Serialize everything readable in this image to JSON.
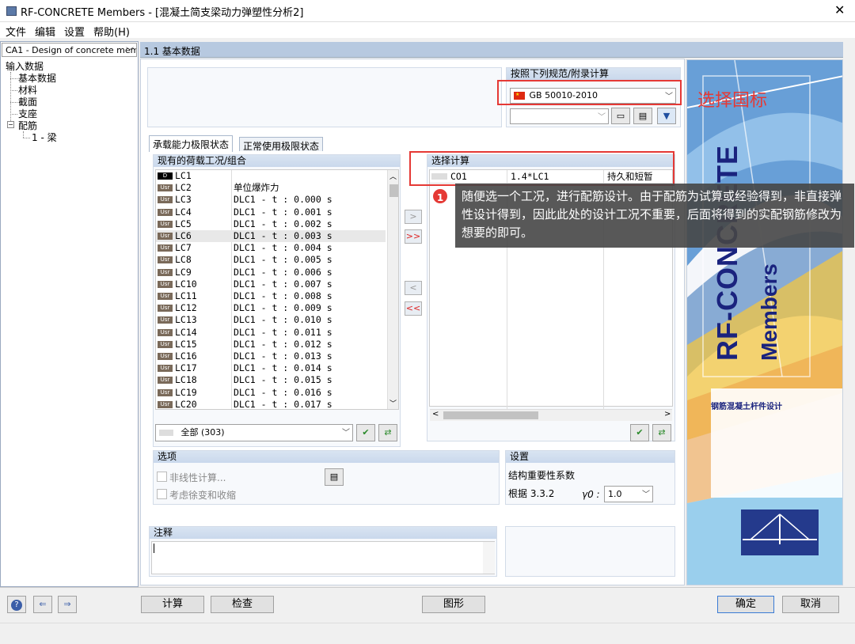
{
  "window": {
    "title": "RF-CONCRETE Members - [混凝土简支梁动力弹塑性分析2]",
    "close_glyph": "✕"
  },
  "menu": [
    "文件",
    "编辑",
    "设置",
    "帮助(H)"
  ],
  "case_select": "CA1 - Design of concrete mem",
  "tree": {
    "root": "输入数据",
    "items": [
      "基本数据",
      "材料",
      "截面",
      "支座",
      "配筋"
    ],
    "sub": "1 - 梁"
  },
  "page_header": "1.1 基本数据",
  "code": {
    "header": "按照下列规范/附录计算",
    "value": "GB 50010-2010"
  },
  "annotation_code": "选择国标",
  "tabs": [
    "承载能力极限状态",
    "正常使用极限状态"
  ],
  "existing": {
    "header": "现有的荷载工况/组合",
    "rows": [
      {
        "badge": "D",
        "name": "LC1",
        "desc": ""
      },
      {
        "badge": "Usr",
        "name": "LC2",
        "desc": "单位爆炸力"
      },
      {
        "badge": "Usr",
        "name": "LC3",
        "desc": "DLC1 - t : 0.000 s"
      },
      {
        "badge": "Usr",
        "name": "LC4",
        "desc": "DLC1 - t : 0.001 s"
      },
      {
        "badge": "Usr",
        "name": "LC5",
        "desc": "DLC1 - t : 0.002 s"
      },
      {
        "badge": "Usr",
        "name": "LC6",
        "desc": "DLC1 - t : 0.003 s"
      },
      {
        "badge": "Usr",
        "name": "LC7",
        "desc": "DLC1 - t : 0.004 s"
      },
      {
        "badge": "Usr",
        "name": "LC8",
        "desc": "DLC1 - t : 0.005 s"
      },
      {
        "badge": "Usr",
        "name": "LC9",
        "desc": "DLC1 - t : 0.006 s"
      },
      {
        "badge": "Usr",
        "name": "LC10",
        "desc": "DLC1 - t : 0.007 s"
      },
      {
        "badge": "Usr",
        "name": "LC11",
        "desc": "DLC1 - t : 0.008 s"
      },
      {
        "badge": "Usr",
        "name": "LC12",
        "desc": "DLC1 - t : 0.009 s"
      },
      {
        "badge": "Usr",
        "name": "LC13",
        "desc": "DLC1 - t : 0.010 s"
      },
      {
        "badge": "Usr",
        "name": "LC14",
        "desc": "DLC1 - t : 0.011 s"
      },
      {
        "badge": "Usr",
        "name": "LC15",
        "desc": "DLC1 - t : 0.012 s"
      },
      {
        "badge": "Usr",
        "name": "LC16",
        "desc": "DLC1 - t : 0.013 s"
      },
      {
        "badge": "Usr",
        "name": "LC17",
        "desc": "DLC1 - t : 0.014 s"
      },
      {
        "badge": "Usr",
        "name": "LC18",
        "desc": "DLC1 - t : 0.015 s"
      },
      {
        "badge": "Usr",
        "name": "LC19",
        "desc": "DLC1 - t : 0.016 s"
      },
      {
        "badge": "Usr",
        "name": "LC20",
        "desc": "DLC1 - t : 0.017 s"
      }
    ],
    "filter": "全部 (303)"
  },
  "selected": {
    "header": "选择计算",
    "rows": [
      {
        "id": "CO1",
        "formula": "1.4*LC1",
        "type": "持久和短暂"
      }
    ]
  },
  "tooltip": {
    "number": "1",
    "text": "随便选一个工况，进行配筋设计。由于配筋为试算或经验得到，非直接弹性设计得到，因此此处的设计工况不重要，后面将得到的实配钢筋修改为想要的即可。"
  },
  "options": {
    "header": "选项",
    "nonlinear": "非线性计算...",
    "creep": "考虑徐变和收缩"
  },
  "settings": {
    "header": "设置",
    "importance": "结构重要性系数",
    "basis": "根据 3.3.2",
    "gamma_label": "γ0 :",
    "gamma_value": "1.0"
  },
  "notes": {
    "header": "注释"
  },
  "branding": {
    "product_line1": "RF-CONCRETE",
    "product_line2": "Members",
    "subtitle": "钢筋混凝土杆件设计"
  },
  "buttons": {
    "calc": "计算",
    "check": "检查",
    "graphics": "图形",
    "ok": "确定",
    "cancel": "取消"
  },
  "colors": {
    "annotation_red": "#e53935",
    "header_blue": "#b7c9e0",
    "brand_navy": "#1a237e"
  }
}
